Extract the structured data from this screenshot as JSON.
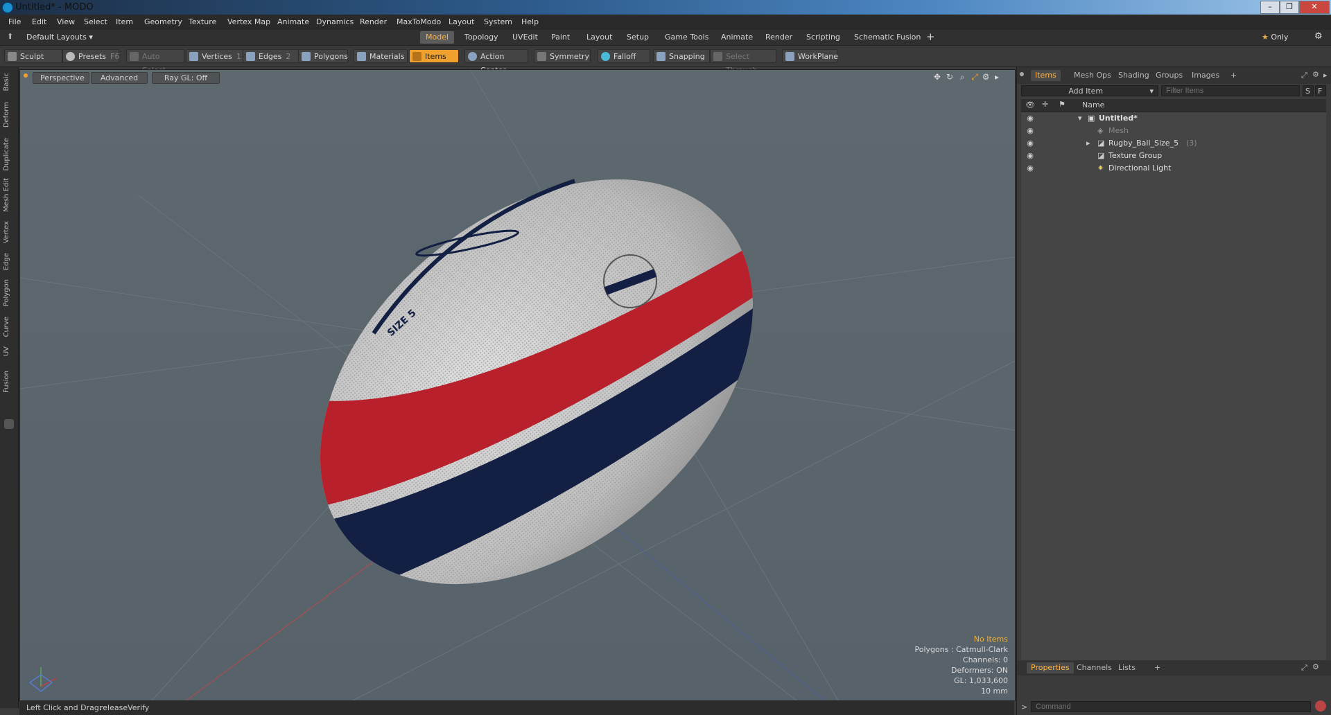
{
  "window": {
    "title": "Untitled* - MODO",
    "buttons": [
      "–",
      "❐",
      "✕"
    ]
  },
  "menu": [
    "File",
    "Edit",
    "View",
    "Select",
    "Item",
    "Geometry",
    "Texture",
    "Vertex Map",
    "Animate",
    "Dynamics",
    "Render",
    "MaxToModo",
    "Layout",
    "System",
    "Help"
  ],
  "layoutbar": {
    "layouts_label": "Default Layouts",
    "tabs": [
      "Model",
      "Topology",
      "UVEdit",
      "Paint",
      "Layout",
      "Setup",
      "Game Tools",
      "Animate",
      "Render",
      "Scripting",
      "Schematic Fusion"
    ],
    "active_tab": "Model",
    "only_label": "Only"
  },
  "toolbar": {
    "sculpt": "Sculpt",
    "presets": "Presets",
    "presets_key": "F6",
    "auto_select": "Auto Select",
    "vertices": "Vertices",
    "vertices_key": "1",
    "edges": "Edges",
    "edges_key": "2",
    "polygons": "Polygons",
    "materials": "Materials",
    "items": "Items",
    "action_center": "Action Center",
    "symmetry": "Symmetry",
    "falloff": "Falloff",
    "snapping": "Snapping",
    "select_through": "Select Through",
    "workplane": "WorkPlane"
  },
  "left_tabs": [
    "Basic",
    "Deform",
    "Duplicate",
    "Mesh Edit",
    "Vertex",
    "Edge",
    "Polygon",
    "Curve",
    "UV",
    "Fusion"
  ],
  "viewport": {
    "perspective": "Perspective",
    "advanced": "Advanced",
    "raygl": "Ray GL: Off",
    "ball_size_text": "SIZE 5",
    "hud": {
      "no_items": "No Items",
      "polygons": "Polygons : Catmull-Clark",
      "channels": "Channels: 0",
      "deformers": "Deformers: ON",
      "gl": "GL: 1,033,600",
      "scale": "10 mm"
    },
    "colors": {
      "red": "#b8202b",
      "navy": "#132044",
      "ball": "#cfcfcf"
    }
  },
  "status": {
    "left": "Left Click and Drag:",
    "right": "releaseVerify"
  },
  "items_panel": {
    "tabs": [
      "Items",
      "Mesh Ops",
      "Shading",
      "Groups",
      "Images"
    ],
    "active_tab": "Items",
    "add_item": "Add Item",
    "filter_placeholder": "Filter Items",
    "s_btn": "S",
    "f_btn": "F",
    "name_header": "Name",
    "tree": [
      {
        "label": "Untitled*",
        "extra": ""
      },
      {
        "label": "Mesh",
        "extra": ""
      },
      {
        "label": "Rugby_Ball_Size_5",
        "extra": "(3)"
      },
      {
        "label": "Texture Group",
        "extra": ""
      },
      {
        "label": "Directional Light",
        "extra": ""
      }
    ]
  },
  "properties_panel": {
    "tabs": [
      "Properties",
      "Channels",
      "Lists"
    ],
    "active_tab": "Properties",
    "command_placeholder": "Command"
  }
}
